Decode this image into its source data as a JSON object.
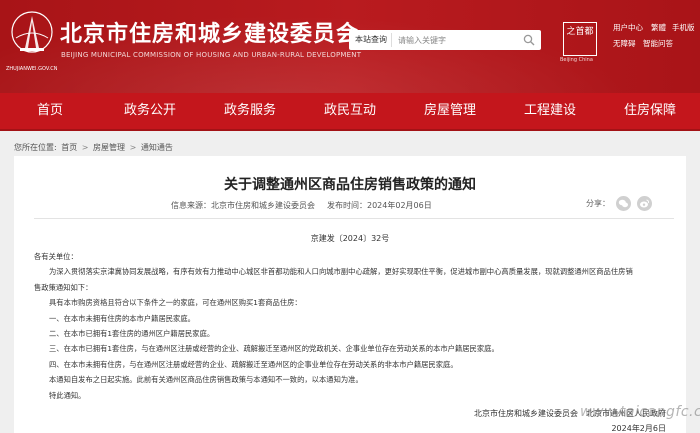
{
  "header": {
    "site_title": "北京市住房和城乡建设委员会",
    "site_subtitle": "BEIJING MUNICIPAL COMMISSION OF HOUSING AND URBAN-RURAL DEVELOPMENT",
    "emblem_text": "ZHUJIANWEI.GOV.CN",
    "search_scope": "本站查询",
    "search_placeholder": "请输入关键字",
    "capital_logo_text": "之首都",
    "capital_caption": "Beijing China",
    "top_links": [
      "用户中心",
      "繁體",
      "手机版",
      "无障碍",
      "智能问答"
    ]
  },
  "nav": {
    "items": [
      "首页",
      "政务公开",
      "政务服务",
      "政民互动",
      "房屋管理",
      "工程建设",
      "住房保障"
    ]
  },
  "breadcrumb": {
    "label": "您所在位置:",
    "items": [
      "首页",
      "房屋管理",
      "通知通告"
    ],
    "separator": ">"
  },
  "article": {
    "title": "关于调整通州区商品住房销售政策的通知",
    "source": "信息来源：北京市住房和城乡建设委员会",
    "published": "发布时间：2024年02月06日",
    "share_label": "分享：",
    "doc_number": "京建发〔2024〕32号",
    "salutation": "各有关单位：",
    "para1a": "为深入贯彻落实京津冀协同发展战略，有序有效有力推动中心城区非首都功能和人口向城市副中心疏解，更好实现职住平衡，促进城市副中心高质量发展，现就调整通州区商品住房销",
    "para1b": "售政策通知如下：",
    "para2": "具有本市购房资格且符合以下条件之一的家庭，可在通州区购买1套商品住房：",
    "item1": "一、在本市未拥有住房的本市户籍居民家庭。",
    "item2": "二、在本市已拥有1套住房的通州区户籍居民家庭。",
    "item3": "三、在本市已拥有1套住房，与在通州区注册或经营的企业、疏解搬迁至通州区的党政机关、企事业单位存在劳动关系的本市户籍居民家庭。",
    "item4": "四、在本市未拥有住房，与在通州区注册或经营的企业、疏解搬迁至通州区的企事业单位存在劳动关系的非本市户籍居民家庭。",
    "para3": "本通知自发布之日起实施。此前有关通州区商品住房销售政策与本通知不一致的，以本通知为准。",
    "closing": "特此通知。",
    "signature": "北京市住房和城乡建设委员会　北京市通州区人民政府",
    "date": "2024年2月6日",
    "watermark": "www.taicangfc.com"
  },
  "colors": {
    "header_red": "#b2161a",
    "nav_red": "#c4161c",
    "page_bg": "#efefef"
  }
}
